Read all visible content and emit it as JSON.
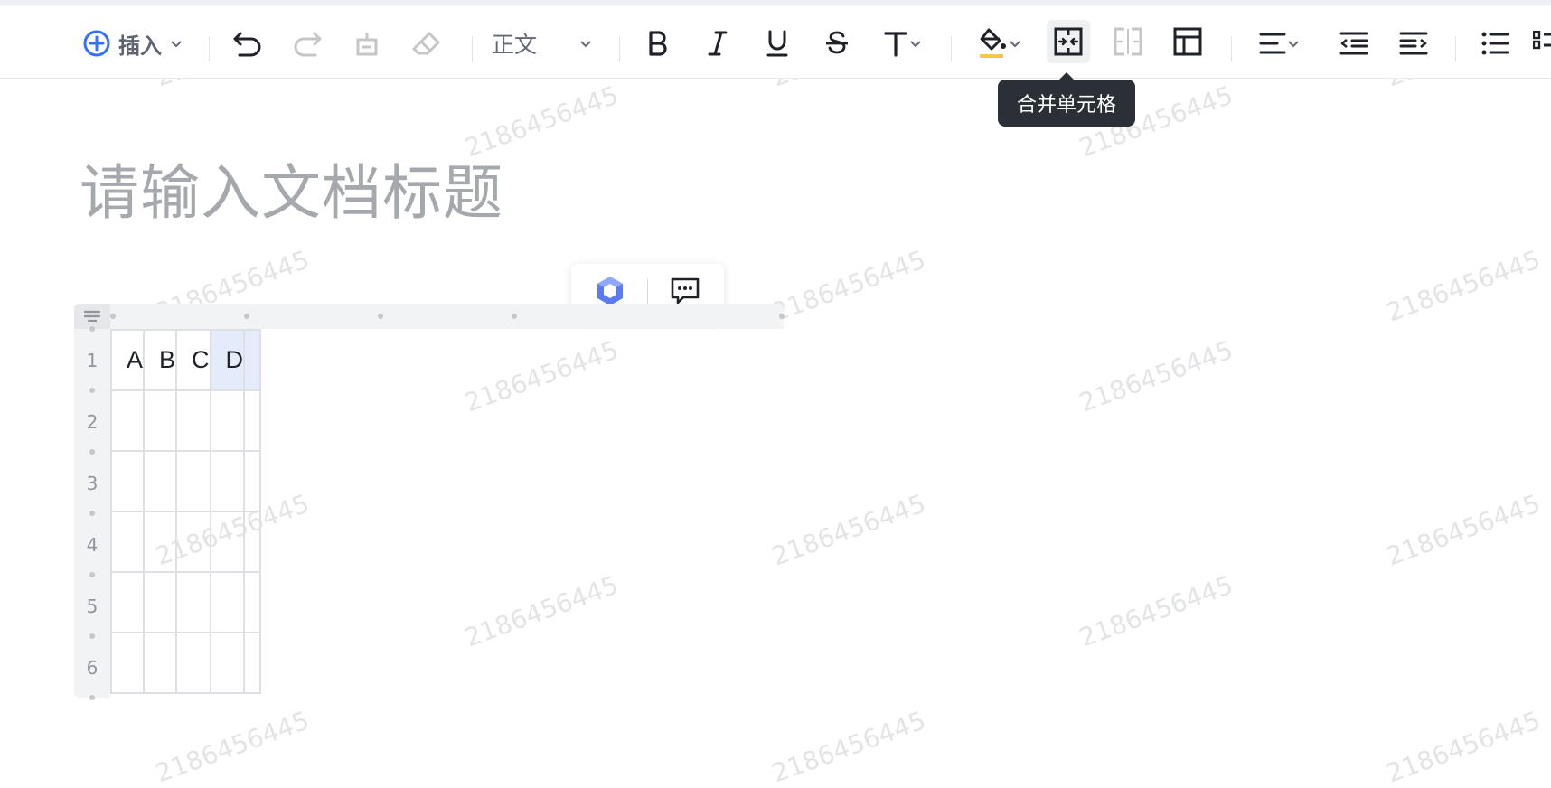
{
  "toolbar": {
    "insert_label": "插入",
    "text_style_label": "正文",
    "tooltip": "合并单元格",
    "icons": [
      "plus-circle-icon",
      "undo-icon",
      "redo-icon",
      "format-painter-icon",
      "eraser-icon",
      "bold-icon",
      "italic-icon",
      "underline-icon",
      "strikethrough-icon",
      "text-format-icon",
      "fill-color-icon",
      "merge-cells-icon",
      "split-cells-icon",
      "table-layout-icon",
      "align-left-icon",
      "outdent-icon",
      "indent-icon",
      "bullet-list-icon"
    ],
    "fill_color": "#f7c843",
    "accent": "#3370ff"
  },
  "document": {
    "title_placeholder": "请输入文档标题"
  },
  "table": {
    "header_row": [
      "A",
      "B",
      "C",
      "D",
      ""
    ],
    "row_numbers": [
      "1",
      "2",
      "3",
      "4",
      "5",
      "6"
    ],
    "selection_color": "#e4ebfb"
  },
  "floating_toolbar": {
    "icons": [
      "ai-assistant-icon",
      "comment-icon"
    ]
  },
  "watermark": "2186456445"
}
